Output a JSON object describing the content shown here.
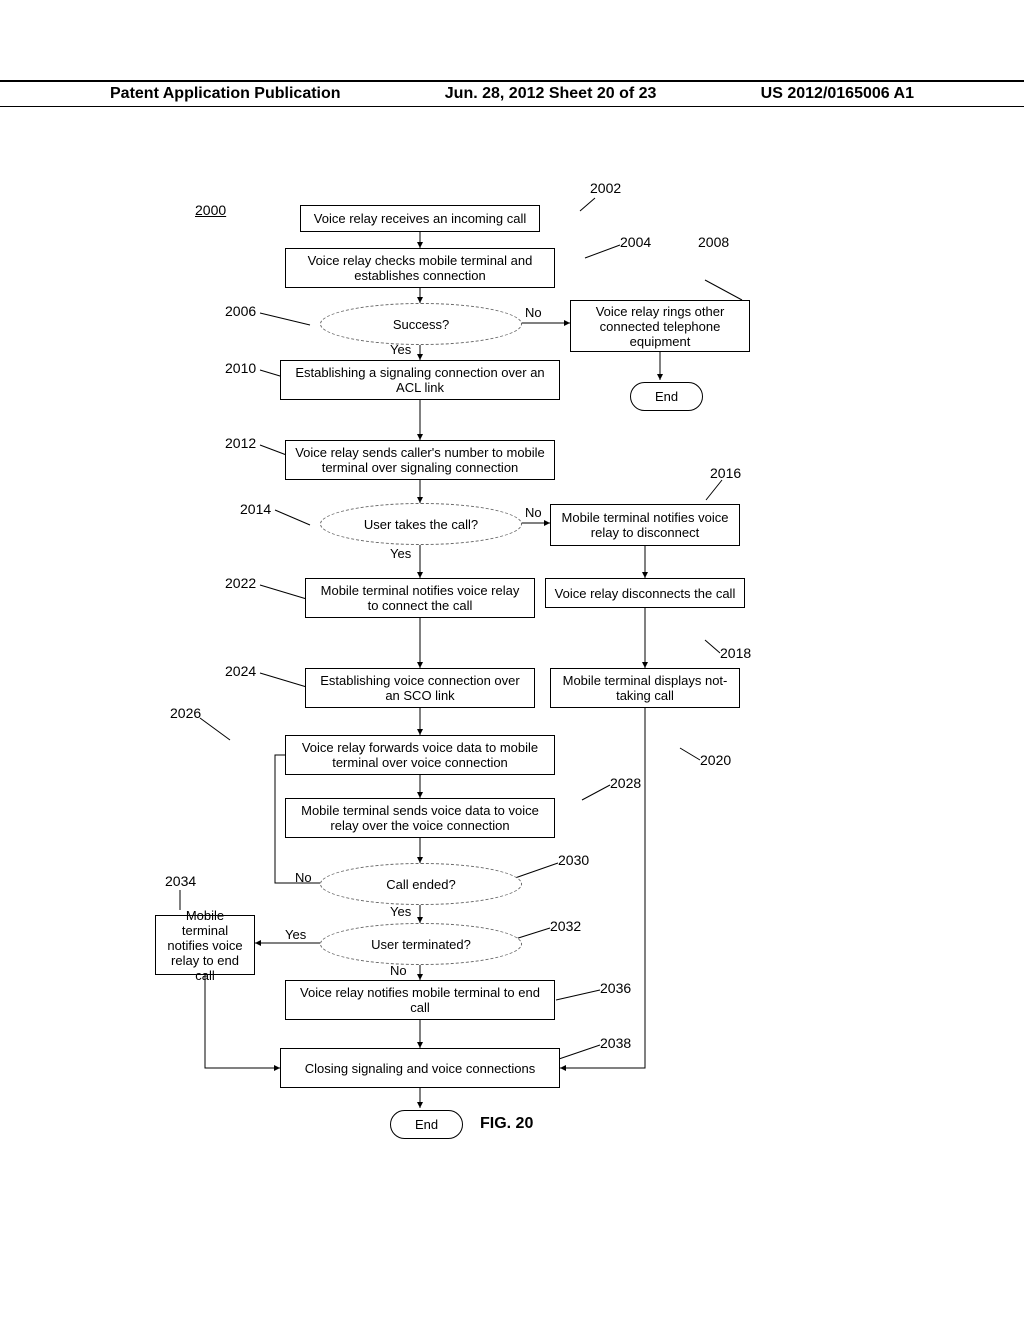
{
  "header": {
    "left": "Patent Application Publication",
    "center": "Jun. 28, 2012  Sheet 20 of 23",
    "right": "US 2012/0165006 A1"
  },
  "refs": {
    "r2000": "2000",
    "r2002": "2002",
    "r2004": "2004",
    "r2006": "2006",
    "r2008": "2008",
    "r2010": "2010",
    "r2012": "2012",
    "r2014": "2014",
    "r2016": "2016",
    "r2018": "2018",
    "r2020": "2020",
    "r2022": "2022",
    "r2024": "2024",
    "r2026": "2026",
    "r2028": "2028",
    "r2030": "2030",
    "r2032": "2032",
    "r2034": "2034",
    "r2036": "2036",
    "r2038": "2038"
  },
  "nodes": {
    "n2002": "Voice relay receives an incoming call",
    "n2004": "Voice relay checks mobile terminal and establishes connection",
    "n2006": "Success?",
    "n2008": "Voice relay rings other connected telephone equipment",
    "n2010": "Establishing a signaling connection over an ACL link",
    "n2012": "Voice relay sends caller's number to mobile terminal over signaling connection",
    "n2014": "User takes the call?",
    "n2016": "Mobile terminal notifies voice relay to disconnect",
    "n2018": "Voice relay disconnects the call",
    "n2020": "Mobile terminal displays not-taking call",
    "n2022": "Mobile terminal notifies voice relay to connect the call",
    "n2024": "Establishing voice connection over an SCO link",
    "n2026": "Voice relay forwards voice data to mobile terminal over voice connection",
    "n2028": "Mobile terminal sends voice data to voice relay over the voice connection",
    "n2030": "Call ended?",
    "n2032": "User terminated?",
    "n2034": "Mobile terminal notifies voice relay to end call",
    "n2036": "Voice relay notifies mobile terminal to end call",
    "n2038": "Closing signaling and voice connections",
    "end1": "End",
    "end2": "End"
  },
  "edges": {
    "yes": "Yes",
    "no": "No"
  },
  "figure": "FIG. 20"
}
